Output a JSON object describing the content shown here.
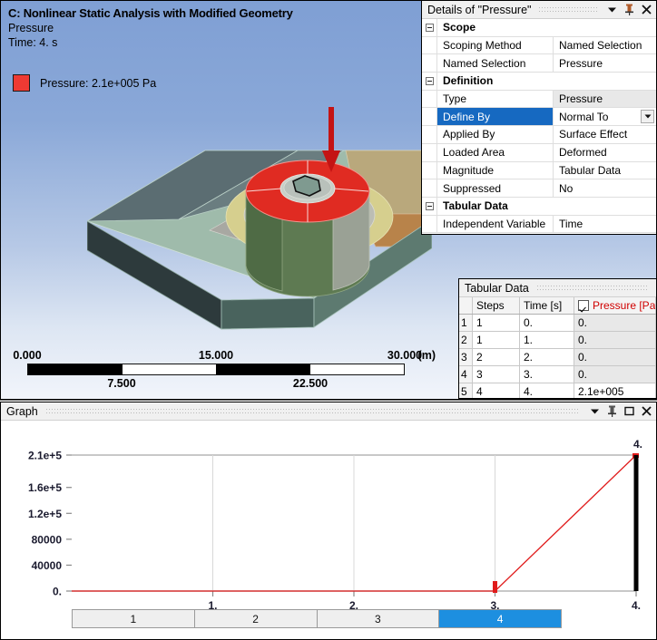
{
  "viewport": {
    "title": "C: Nonlinear Static Analysis with Modified Geometry",
    "subtitle": "Pressure",
    "time": "Time: 4. s",
    "legend_label": "Pressure: 2.1e+005 Pa",
    "legend_color": "#ee3a33",
    "scale": {
      "labels_top": [
        "0.000",
        "15.000",
        "30.000"
      ],
      "labels_bottom": [
        "7.500",
        "22.500"
      ],
      "unit": "(m)"
    }
  },
  "details": {
    "title": "Details of \"Pressure\"",
    "controls": [
      "chevron-down-icon",
      "pin-icon",
      "close-icon"
    ],
    "groups": [
      {
        "header": "Scope",
        "rows": [
          {
            "key": "Scoping Method",
            "value": "Named Selection",
            "style": "plain"
          },
          {
            "key": "Named Selection",
            "value": "Pressure",
            "style": "plain"
          }
        ]
      },
      {
        "header": "Definition",
        "rows": [
          {
            "key": "Type",
            "value": "Pressure",
            "style": "grey"
          },
          {
            "key": "Define By",
            "value": "Normal To",
            "style": "selected-combo"
          },
          {
            "key": "Applied By",
            "value": "Surface Effect",
            "style": "plain"
          },
          {
            "key": "Loaded Area",
            "value": "Deformed",
            "style": "plain"
          },
          {
            "key": "Magnitude",
            "value": "Tabular Data",
            "style": "plain"
          },
          {
            "key": "Suppressed",
            "value": "No",
            "style": "plain"
          }
        ]
      },
      {
        "header": "Tabular Data",
        "rows": [
          {
            "key": "Independent Variable",
            "value": "Time",
            "style": "plain"
          }
        ]
      }
    ]
  },
  "tabular": {
    "title": "Tabular Data",
    "columns": [
      "",
      "Steps",
      "Time [s]",
      "Pressure [Pa]"
    ],
    "pressure_checked": true,
    "rows": [
      {
        "idx": "1",
        "steps": "1",
        "time": "0.",
        "pressure": "0."
      },
      {
        "idx": "2",
        "steps": "1",
        "time": "1.",
        "pressure": "0."
      },
      {
        "idx": "3",
        "steps": "2",
        "time": "2.",
        "pressure": "0."
      },
      {
        "idx": "4",
        "steps": "3",
        "time": "3.",
        "pressure": "0."
      },
      {
        "idx": "5",
        "steps": "4",
        "time": "4.",
        "pressure": "2.1e+005"
      },
      {
        "idx": "",
        "steps": "",
        "time": "",
        "pressure": ""
      }
    ]
  },
  "graph": {
    "title": "Graph",
    "controls": [
      "chevron-down-icon",
      "pin-icon",
      "maximize-icon",
      "close-icon"
    ],
    "marker_label": "4.",
    "steps": [
      {
        "label": "1",
        "active": false
      },
      {
        "label": "2",
        "active": false
      },
      {
        "label": "3",
        "active": false
      },
      {
        "label": "4",
        "active": true
      }
    ]
  },
  "chart_data": {
    "type": "line",
    "title": "Graph",
    "xlabel": "",
    "ylabel": "",
    "series": [
      {
        "name": "Pressure [Pa]",
        "color": "#e01b1b",
        "x": [
          0,
          1,
          2,
          3,
          4
        ],
        "y": [
          0,
          0,
          0,
          0,
          210000
        ]
      }
    ],
    "x_ticks": [
      "1.",
      "2.",
      "3.",
      "4."
    ],
    "x_tick_values": [
      1,
      2,
      3,
      4
    ],
    "xlim": [
      0,
      4
    ],
    "y_ticks": [
      "0.",
      "40000",
      "80000",
      "1.2e+5",
      "1.6e+5",
      "2.1e+5"
    ],
    "y_tick_values": [
      0,
      40000,
      80000,
      120000,
      160000,
      210000
    ],
    "ylim": [
      0,
      210000
    ],
    "grid": true,
    "legend": "none",
    "annotations": [
      {
        "text": "4.",
        "x": 4,
        "y": 210000,
        "kind": "time-marker-label"
      }
    ],
    "time_marker": {
      "x": 4,
      "color": "#000000"
    }
  }
}
